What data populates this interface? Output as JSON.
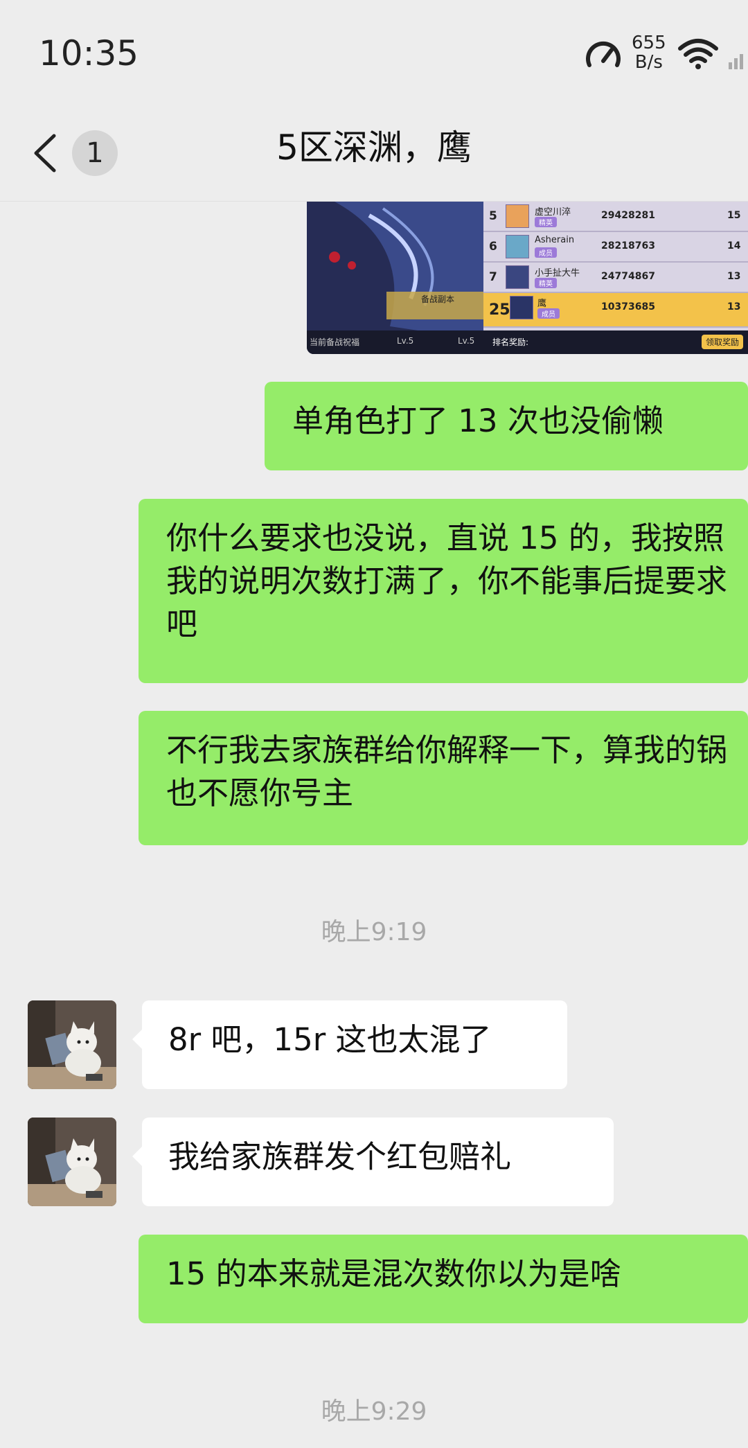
{
  "status_bar": {
    "time": "10:35",
    "net_speed_value": "655",
    "net_speed_unit": "B/s"
  },
  "header": {
    "title": "5区深渊，鹰",
    "unread_count": "1"
  },
  "image": {
    "ranking": [
      {
        "rank": "5",
        "name": "虚空川淬",
        "tag": "精英",
        "score": "29428281",
        "count": "15"
      },
      {
        "rank": "6",
        "name": "Asherain",
        "tag": "成员",
        "score": "28218763",
        "count": "14"
      },
      {
        "rank": "7",
        "name": "小手扯大牛",
        "tag": "精英",
        "score": "24774867",
        "count": "13"
      },
      {
        "rank": "25",
        "name": "鹰",
        "tag": "成员",
        "score": "10373685",
        "count": "13"
      }
    ],
    "footer_left": "当前备战祝福",
    "footer_level1": "Lv.5",
    "footer_level2": "Lv.5",
    "footer_reward": "排名奖励:",
    "footer_button": "领取奖励",
    "art_banner": "备战副本"
  },
  "messages": [
    {
      "type": "out",
      "text": "单角色打了 13 次也没偷懒"
    },
    {
      "type": "out",
      "text": "你什么要求也没说，直说 15 的，我按照我的说明次数打满了，你不能事后提要求吧"
    },
    {
      "type": "out",
      "text": "不行我去家族群给你解释一下，算我的锅也不愿你号主"
    },
    {
      "type": "time",
      "text": "晚上9:19"
    },
    {
      "type": "in",
      "text": "8r 吧，15r 这也太混了"
    },
    {
      "type": "in",
      "text": "我给家族群发个红包赔礼"
    },
    {
      "type": "out",
      "text": "15 的本来就是混次数你以为是啥"
    },
    {
      "type": "time",
      "text": "晚上9:29"
    }
  ]
}
